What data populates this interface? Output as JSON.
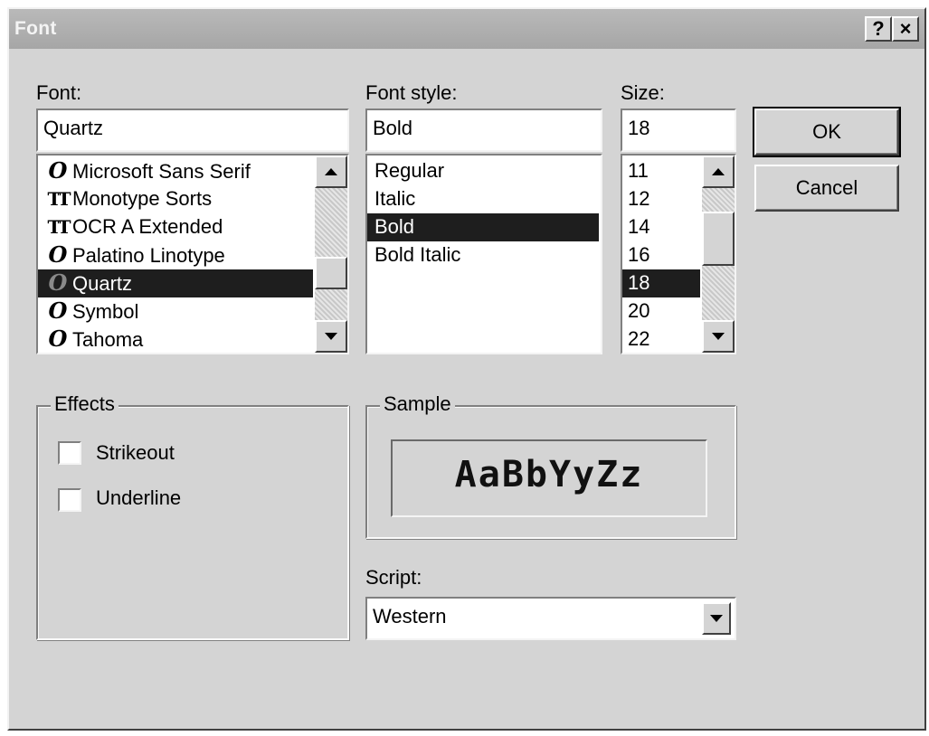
{
  "window": {
    "title": "Font",
    "help_button": "?",
    "close_button": "×"
  },
  "font": {
    "label": "Font:",
    "value": "Quartz",
    "items": [
      {
        "name": "Microsoft Sans Serif",
        "icon": "opentype-icon",
        "glyph": "O"
      },
      {
        "name": "Monotype Sorts",
        "icon": "truetype-icon",
        "glyph": "TT"
      },
      {
        "name": "OCR A Extended",
        "icon": "truetype-icon",
        "glyph": "TT"
      },
      {
        "name": "Palatino Linotype",
        "icon": "opentype-icon",
        "glyph": "O"
      },
      {
        "name": "Quartz",
        "icon": "opentype-icon",
        "glyph": "O",
        "selected": true
      },
      {
        "name": "Symbol",
        "icon": "opentype-icon",
        "glyph": "O"
      },
      {
        "name": "Tahoma",
        "icon": "opentype-icon",
        "glyph": "O"
      }
    ]
  },
  "style": {
    "label": "Font style:",
    "value": "Bold",
    "items": [
      "Regular",
      "Italic",
      "Bold",
      "Bold Italic"
    ],
    "selected_index": 2
  },
  "size": {
    "label": "Size:",
    "value": "18",
    "items": [
      "11",
      "12",
      "14",
      "16",
      "18",
      "20",
      "22"
    ],
    "selected_index": 4
  },
  "buttons": {
    "ok": "OK",
    "cancel": "Cancel"
  },
  "effects": {
    "label": "Effects",
    "strikeout": "Strikeout",
    "underline": "Underline",
    "strikeout_checked": false,
    "underline_checked": false
  },
  "sample": {
    "label": "Sample",
    "text": "AaBbYyZz"
  },
  "script": {
    "label": "Script:",
    "value": "Western"
  },
  "colors": {
    "selection": "#1e1e1e",
    "face": "#d4d4d4"
  }
}
